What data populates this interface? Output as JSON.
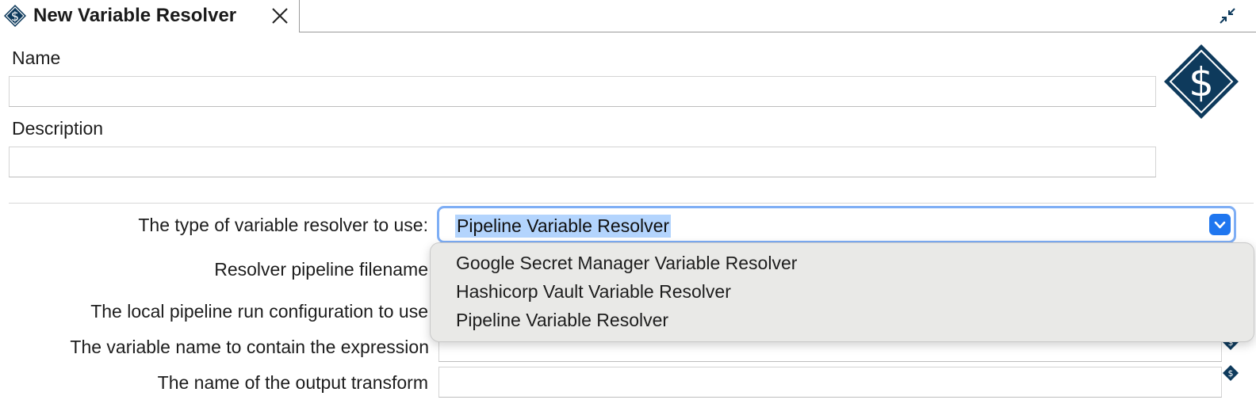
{
  "tab": {
    "title": "New Variable Resolver",
    "icon": "variable-resolver-icon",
    "close_icon": "close-icon"
  },
  "window": {
    "minimize_icon": "minimize-icon"
  },
  "colors": {
    "brand": "#0e3a5c",
    "focus_ring": "#7eaef5",
    "selection": "#b3d4fd",
    "combo_button": "#1f76ef",
    "dropdown_bg": "#e9e9e7"
  },
  "form": {
    "name_label": "Name",
    "name_value": "",
    "description_label": "Description",
    "description_value": "",
    "type_label": "The type of variable resolver to use:",
    "type_selected": "Pipeline Variable Resolver",
    "type_options": [
      "Google Secret Manager Variable Resolver",
      "Hashicorp Vault Variable Resolver",
      "Pipeline Variable Resolver"
    ],
    "pipeline_filename_label": "Resolver pipeline filename",
    "run_config_label": "The local pipeline run configuration to use",
    "variable_name_label": "The variable name to contain the expression",
    "output_transform_label": "The name of the output transform",
    "output_transform_value": ""
  }
}
